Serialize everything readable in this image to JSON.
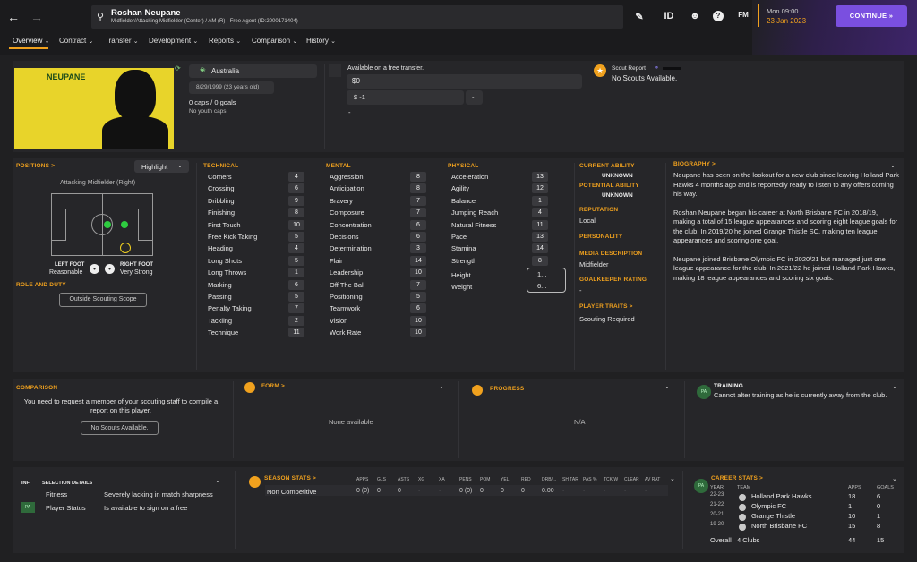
{
  "header": {
    "player_name": "Roshan Neupane",
    "player_sub": "Midfielder/Attacking Midfielder (Center) / AM (R) - Free Agent (ID:2000171404)",
    "icons": [
      "back-arrow-icon",
      "forward-arrow-icon",
      "search-icon",
      "edit-icon",
      "id-icon",
      "assistant-icon",
      "help-icon",
      "fm-icon"
    ],
    "id_label": "ID",
    "fm_label": "FM",
    "help_label": "?",
    "time": "Mon 09:00",
    "date": "23 Jan 2023",
    "continue_label": "CONTINUE"
  },
  "tabs": [
    "Overview",
    "Contract",
    "Transfer",
    "Development",
    "Reports",
    "Comparison",
    "History"
  ],
  "profile": {
    "shirt_name": "NEUPANE",
    "nation": "Australia",
    "dob": "8/29/1999 (23 years old)",
    "caps": "0 caps / 0 goals",
    "youth_caps": "No youth caps"
  },
  "transfer": {
    "label": "Available on a free transfer.",
    "value": "$0",
    "wage": "$ -1",
    "dash": "-",
    "minus": "-"
  },
  "scout": {
    "title": "Scout Report",
    "text": "No Scouts Available."
  },
  "positions": {
    "title": "POSITIONS >",
    "highlight": "Highlight",
    "role_label": "Attacking Midfielder (Right)",
    "left_foot_label": "LEFT FOOT",
    "left_foot_value": "Reasonable",
    "right_foot_label": "RIGHT FOOT",
    "right_foot_value": "Very Strong",
    "role_duty": "ROLE AND DUTY",
    "outside_scope": "Outside Scouting Scope"
  },
  "technical": {
    "title": "TECHNICAL",
    "items": [
      [
        "Corners",
        "4"
      ],
      [
        "Crossing",
        "6"
      ],
      [
        "Dribbling",
        "9"
      ],
      [
        "Finishing",
        "8"
      ],
      [
        "First Touch",
        "10"
      ],
      [
        "Free Kick Taking",
        "5"
      ],
      [
        "Heading",
        "4"
      ],
      [
        "Long Shots",
        "5"
      ],
      [
        "Long Throws",
        "1"
      ],
      [
        "Marking",
        "6"
      ],
      [
        "Passing",
        "5"
      ],
      [
        "Penalty Taking",
        "7"
      ],
      [
        "Tackling",
        "2"
      ],
      [
        "Technique",
        "11"
      ]
    ]
  },
  "mental": {
    "title": "MENTAL",
    "items": [
      [
        "Aggression",
        "8"
      ],
      [
        "Anticipation",
        "8"
      ],
      [
        "Bravery",
        "7"
      ],
      [
        "Composure",
        "7"
      ],
      [
        "Concentration",
        "6"
      ],
      [
        "Decisions",
        "6"
      ],
      [
        "Determination",
        "3"
      ],
      [
        "Flair",
        "14"
      ],
      [
        "Leadership",
        "10"
      ],
      [
        "Off The Ball",
        "7"
      ],
      [
        "Positioning",
        "5"
      ],
      [
        "Teamwork",
        "6"
      ],
      [
        "Vision",
        "10"
      ],
      [
        "Work Rate",
        "10"
      ]
    ]
  },
  "physical": {
    "title": "PHYSICAL",
    "items": [
      [
        "Acceleration",
        "13"
      ],
      [
        "Agility",
        "12"
      ],
      [
        "Balance",
        "1"
      ],
      [
        "Jumping Reach",
        "4"
      ],
      [
        "Natural Fitness",
        "11"
      ],
      [
        "Pace",
        "13"
      ],
      [
        "Stamina",
        "14"
      ],
      [
        "Strength",
        "8"
      ]
    ],
    "height_label": "Height",
    "height_value": "1...",
    "weight_label": "Weight",
    "weight_value": "6..."
  },
  "ability": {
    "current_label": "CURRENT ABILITY",
    "current_value": "UNKNOWN",
    "potential_label": "POTENTIAL ABILITY",
    "potential_value": "UNKNOWN",
    "reputation_label": "REPUTATION",
    "reputation_value": "Local",
    "personality_label": "PERSONALITY",
    "media_label": "MEDIA DESCRIPTION",
    "media_value": "Midfielder",
    "gk_label": "GOALKEEPER RATING",
    "gk_value": "-",
    "traits_label": "PLAYER TRAITS >",
    "traits_value": "Scouting Required"
  },
  "biography": {
    "title": "BIOGRAPHY >",
    "p1": "Neupane has been on the lookout for a new club since leaving Holland Park Hawks 4 months ago and is reportedly ready to listen to any offers coming his way.",
    "p2": "Roshan Neupane began his career at North Brisbane FC in 2018/19, making a total of 15 league appearances and scoring eight league goals for the club. In 2019/20 he joined Grange Thistle SC, making ten league appearances and scoring one goal.",
    "p3": "Neupane joined Brisbane Olympic FC in 2020/21 but managed just one league appearance for the club. In 2021/22 he joined Holland Park Hawks, making 18 league appearances and scoring six goals."
  },
  "comparison": {
    "title": "COMPARISON",
    "text": "You need to request a member of your scouting staff to compile a report on this player.",
    "button": "No Scouts Available."
  },
  "form": {
    "title": "FORM >",
    "empty": "None available"
  },
  "progress": {
    "title": "PROGRESS",
    "empty": "N/A"
  },
  "training": {
    "title": "TRAINING",
    "text": "Cannot alter training as he is currently away from the club.",
    "badge": "PA"
  },
  "selection": {
    "inf": "INF",
    "title": "SELECTION DETAILS",
    "fitness_label": "Fitness",
    "fitness_value": "Severely lacking in match sharpness",
    "status_label": "Player Status",
    "status_value": "Is available to sign on a free",
    "badge": "PA"
  },
  "season": {
    "title": "SEASON STATS >",
    "headers": [
      "APPS",
      "GLS",
      "ASTS",
      "XG",
      "XA",
      "PENS",
      "POM",
      "YEL",
      "RED",
      "DRB/...",
      "SH TAR",
      "PAS %",
      "TCK W",
      "CLEAR",
      "AV RAT"
    ],
    "row_label": "Non Competitive",
    "row": [
      "0 (0)",
      "0",
      "0",
      "-",
      "-",
      "0 (0)",
      "0",
      "0",
      "0",
      "0.00",
      "-",
      "-",
      "-",
      "-",
      "-"
    ]
  },
  "career": {
    "title": "CAREER STATS >",
    "h_year": "YEAR",
    "h_team": "TEAM",
    "h_apps": "APPS",
    "h_goals": "GOALS",
    "rows": [
      [
        "22-23",
        "Holland Park Hawks",
        "18",
        "6"
      ],
      [
        "21-22",
        "Olympic FC",
        "1",
        "0"
      ],
      [
        "20-21",
        "Grange Thistle",
        "10",
        "1"
      ],
      [
        "19-20",
        "North Brisbane FC",
        "15",
        "8"
      ]
    ],
    "overall_label": "Overall",
    "overall_clubs": "4 Clubs",
    "overall_apps": "44",
    "overall_goals": "15",
    "badge": "PA"
  },
  "colors": {
    "accent": "#f0a11e",
    "continue": "#7a4fe0",
    "shirt": "#e8d42a"
  }
}
